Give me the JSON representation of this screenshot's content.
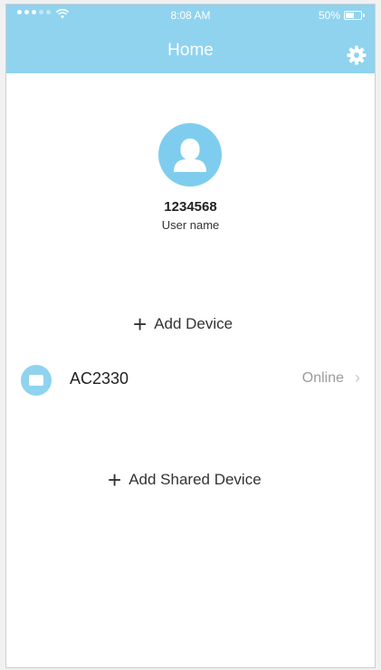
{
  "status_bar": {
    "time": "8:08 AM",
    "battery": "50%",
    "battery_level": 0.5,
    "signal_icon": "signal-dots-icon",
    "wifi_icon": "wifi-icon"
  },
  "header": {
    "title": "Home",
    "settings_icon": "gear-icon",
    "color": "#8fd3ef"
  },
  "user": {
    "id": "1234568",
    "name": "User name",
    "avatar_icon": "user-icon"
  },
  "actions": {
    "add_device_label": "Add Device",
    "add_shared_device_label": "Add Shared Device",
    "plus_icon": "+"
  },
  "devices": [
    {
      "name": "AC2330",
      "status": "Online",
      "icon": "device-icon",
      "chevron": "›"
    }
  ]
}
